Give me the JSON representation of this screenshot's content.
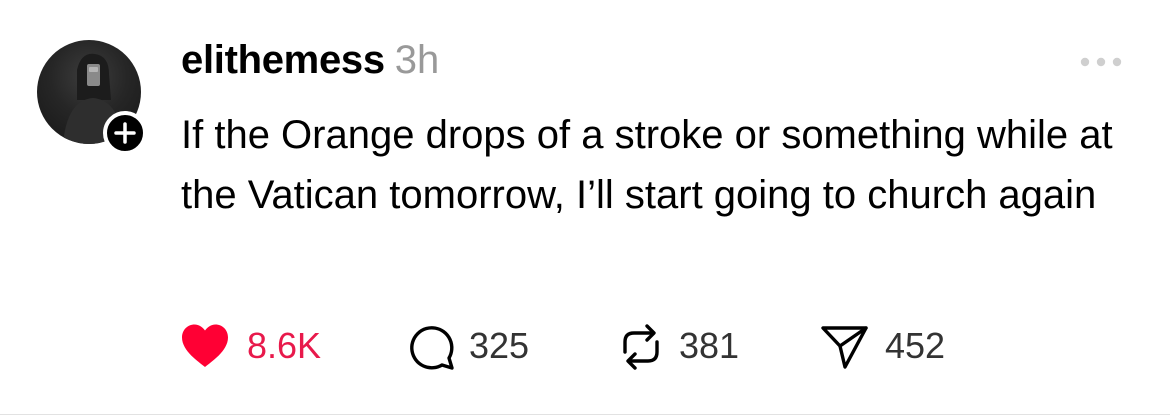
{
  "post": {
    "author": {
      "username": "elithemess",
      "avatar_icon": "profile-photo",
      "follow_icon": "plus-icon"
    },
    "timestamp": "3h",
    "more_icon": "more-dots-icon",
    "text": "If the Orange drops of a stroke or something while at the Vatican tomorrow, I’ll start going to church again",
    "actions": {
      "likes": {
        "icon": "heart-icon",
        "count": "8.6K",
        "liked": true,
        "color": "#ff0034"
      },
      "replies": {
        "icon": "comment-icon",
        "count": "325"
      },
      "reposts": {
        "icon": "repost-icon",
        "count": "381"
      },
      "shares": {
        "icon": "send-icon",
        "count": "452"
      }
    }
  }
}
